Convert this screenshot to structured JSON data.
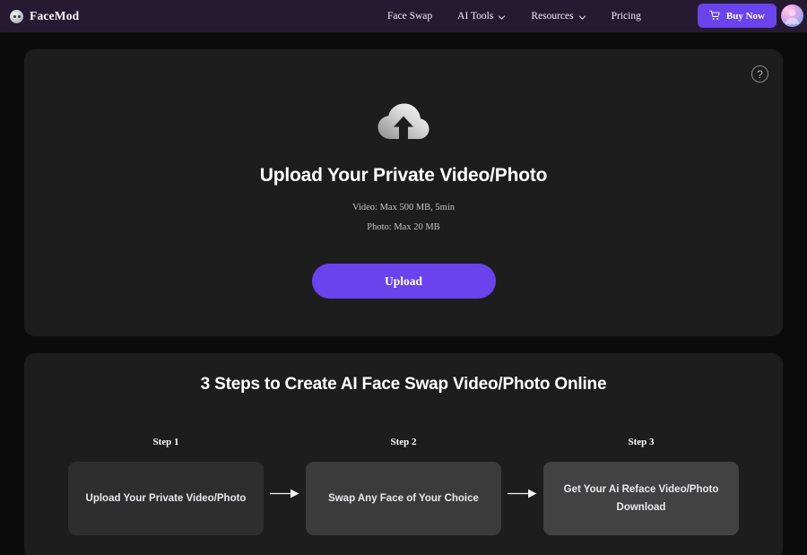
{
  "header": {
    "brand": {
      "name": "FaceMod",
      "icon": "face-logo-icon"
    },
    "nav": [
      {
        "label": "Face Swap",
        "has_dropdown": false
      },
      {
        "label": "AI Tools",
        "has_dropdown": true
      },
      {
        "label": "Resources",
        "has_dropdown": true
      },
      {
        "label": "Pricing",
        "has_dropdown": false
      }
    ],
    "buy_button": {
      "label": "Buy Now",
      "icon": "shopping-cart-icon",
      "color": "#6a43ec"
    },
    "avatar": {
      "icon": "user-avatar-icon"
    },
    "background_color": "#261a33"
  },
  "upload_card": {
    "help_icon_label": "?",
    "cloud_icon": "cloud-upload-icon",
    "title": "Upload Your Private Video/Photo",
    "limit_video": "Video: Max 500 MB, 5min",
    "limit_photo": "Photo: Max 20 MB",
    "upload_button_label": "Upload",
    "accent_color": "#6a43ec"
  },
  "steps_section": {
    "title": "3 Steps to Create AI Face Swap Video/Photo Online",
    "steps": [
      {
        "label": "Step 1",
        "text": "Upload Your Private Video/Photo"
      },
      {
        "label": "Step 2",
        "text": "Swap Any Face of Your Choice"
      },
      {
        "label": "Step 3",
        "line1": "Get Your Ai Reface Video/Photo",
        "line2": "Download"
      }
    ],
    "arrow_icon": "arrow-right-icon"
  }
}
